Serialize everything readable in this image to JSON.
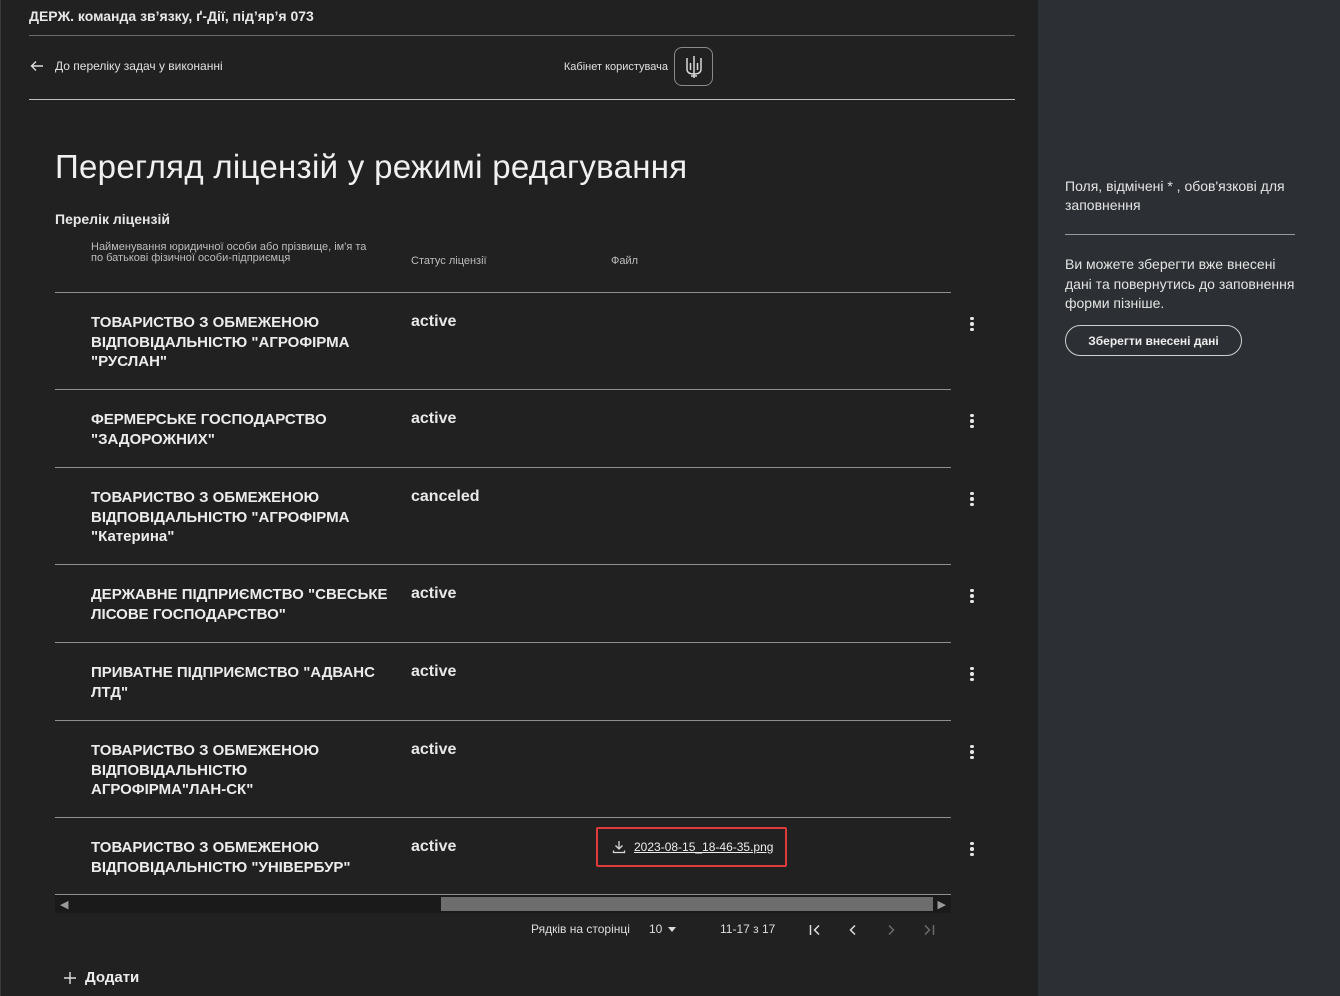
{
  "header": {
    "org_name": "ДЕРЖ. команда зв’язку, ґ-Дії, під’яр’я 073",
    "back_link": "До переліку задач у виконанні",
    "cabinet_label": "Кабінет користувача"
  },
  "page": {
    "title": "Перегляд ліцензій у режимі редагування",
    "list_label": "Перелік ліцензій"
  },
  "table": {
    "columns": {
      "name": "Найменування юридичної особи або прізвище, ім'я та по батькові фізичної особи-підприємця",
      "status": "Статус ліцензії",
      "file": "Файл"
    },
    "rows": [
      {
        "name": "ТОВАРИСТВО З ОБМЕЖЕНОЮ ВІДПОВІДАЛЬНІСТЮ \"АГРОФІРМА \"РУСЛАН\"",
        "status": "active",
        "file": ""
      },
      {
        "name": "ФЕРМЕРСЬКЕ ГОСПОДАРСТВО \"ЗАДОРОЖНИХ\"",
        "status": "active",
        "file": ""
      },
      {
        "name": "ТОВАРИСТВО З ОБМЕЖЕНОЮ ВІДПОВІДАЛЬНІСТЮ \"АГРОФІРМА \"Катерина\"",
        "status": "canceled",
        "file": ""
      },
      {
        "name": "ДЕРЖАВНЕ ПІДПРИЄМСТВО \"СВЕСЬКЕ ЛІСОВЕ ГОСПОДАРСТВО\"",
        "status": "active",
        "file": ""
      },
      {
        "name": "ПРИВАТНЕ ПІДПРИЄМСТВО \"АДВАНС ЛТД\"",
        "status": "active",
        "file": ""
      },
      {
        "name": "ТОВАРИСТВО З ОБМЕЖЕНОЮ ВІДПОВІДАЛЬНІСТЮ АГРОФІРМА\"ЛАН-СК\"",
        "status": "active",
        "file": ""
      },
      {
        "name": "ТОВАРИСТВО З ОБМЕЖЕНОЮ ВІДПОВІДАЛЬНІСТЮ \"УНІВЕРБУР\"",
        "status": "active",
        "file": "2023-08-15_18-46-35.png"
      }
    ]
  },
  "pagination": {
    "rows_per_page_label": "Рядків на сторінці",
    "rows_per_page_value": "10",
    "range": "11-17 з 17"
  },
  "add_label": "Додати",
  "sidebar": {
    "required_note": "Поля, відмічені * , обов'язкові для заповнення",
    "save_note": "Ви можете зберегти вже внесені дані та повернутись до заповнення форми пізніше.",
    "save_button": "Зберегти внесені дані"
  },
  "colors": {
    "background": "#212121",
    "sidebar": "#2c2f33",
    "highlight": "#e03b3b"
  }
}
